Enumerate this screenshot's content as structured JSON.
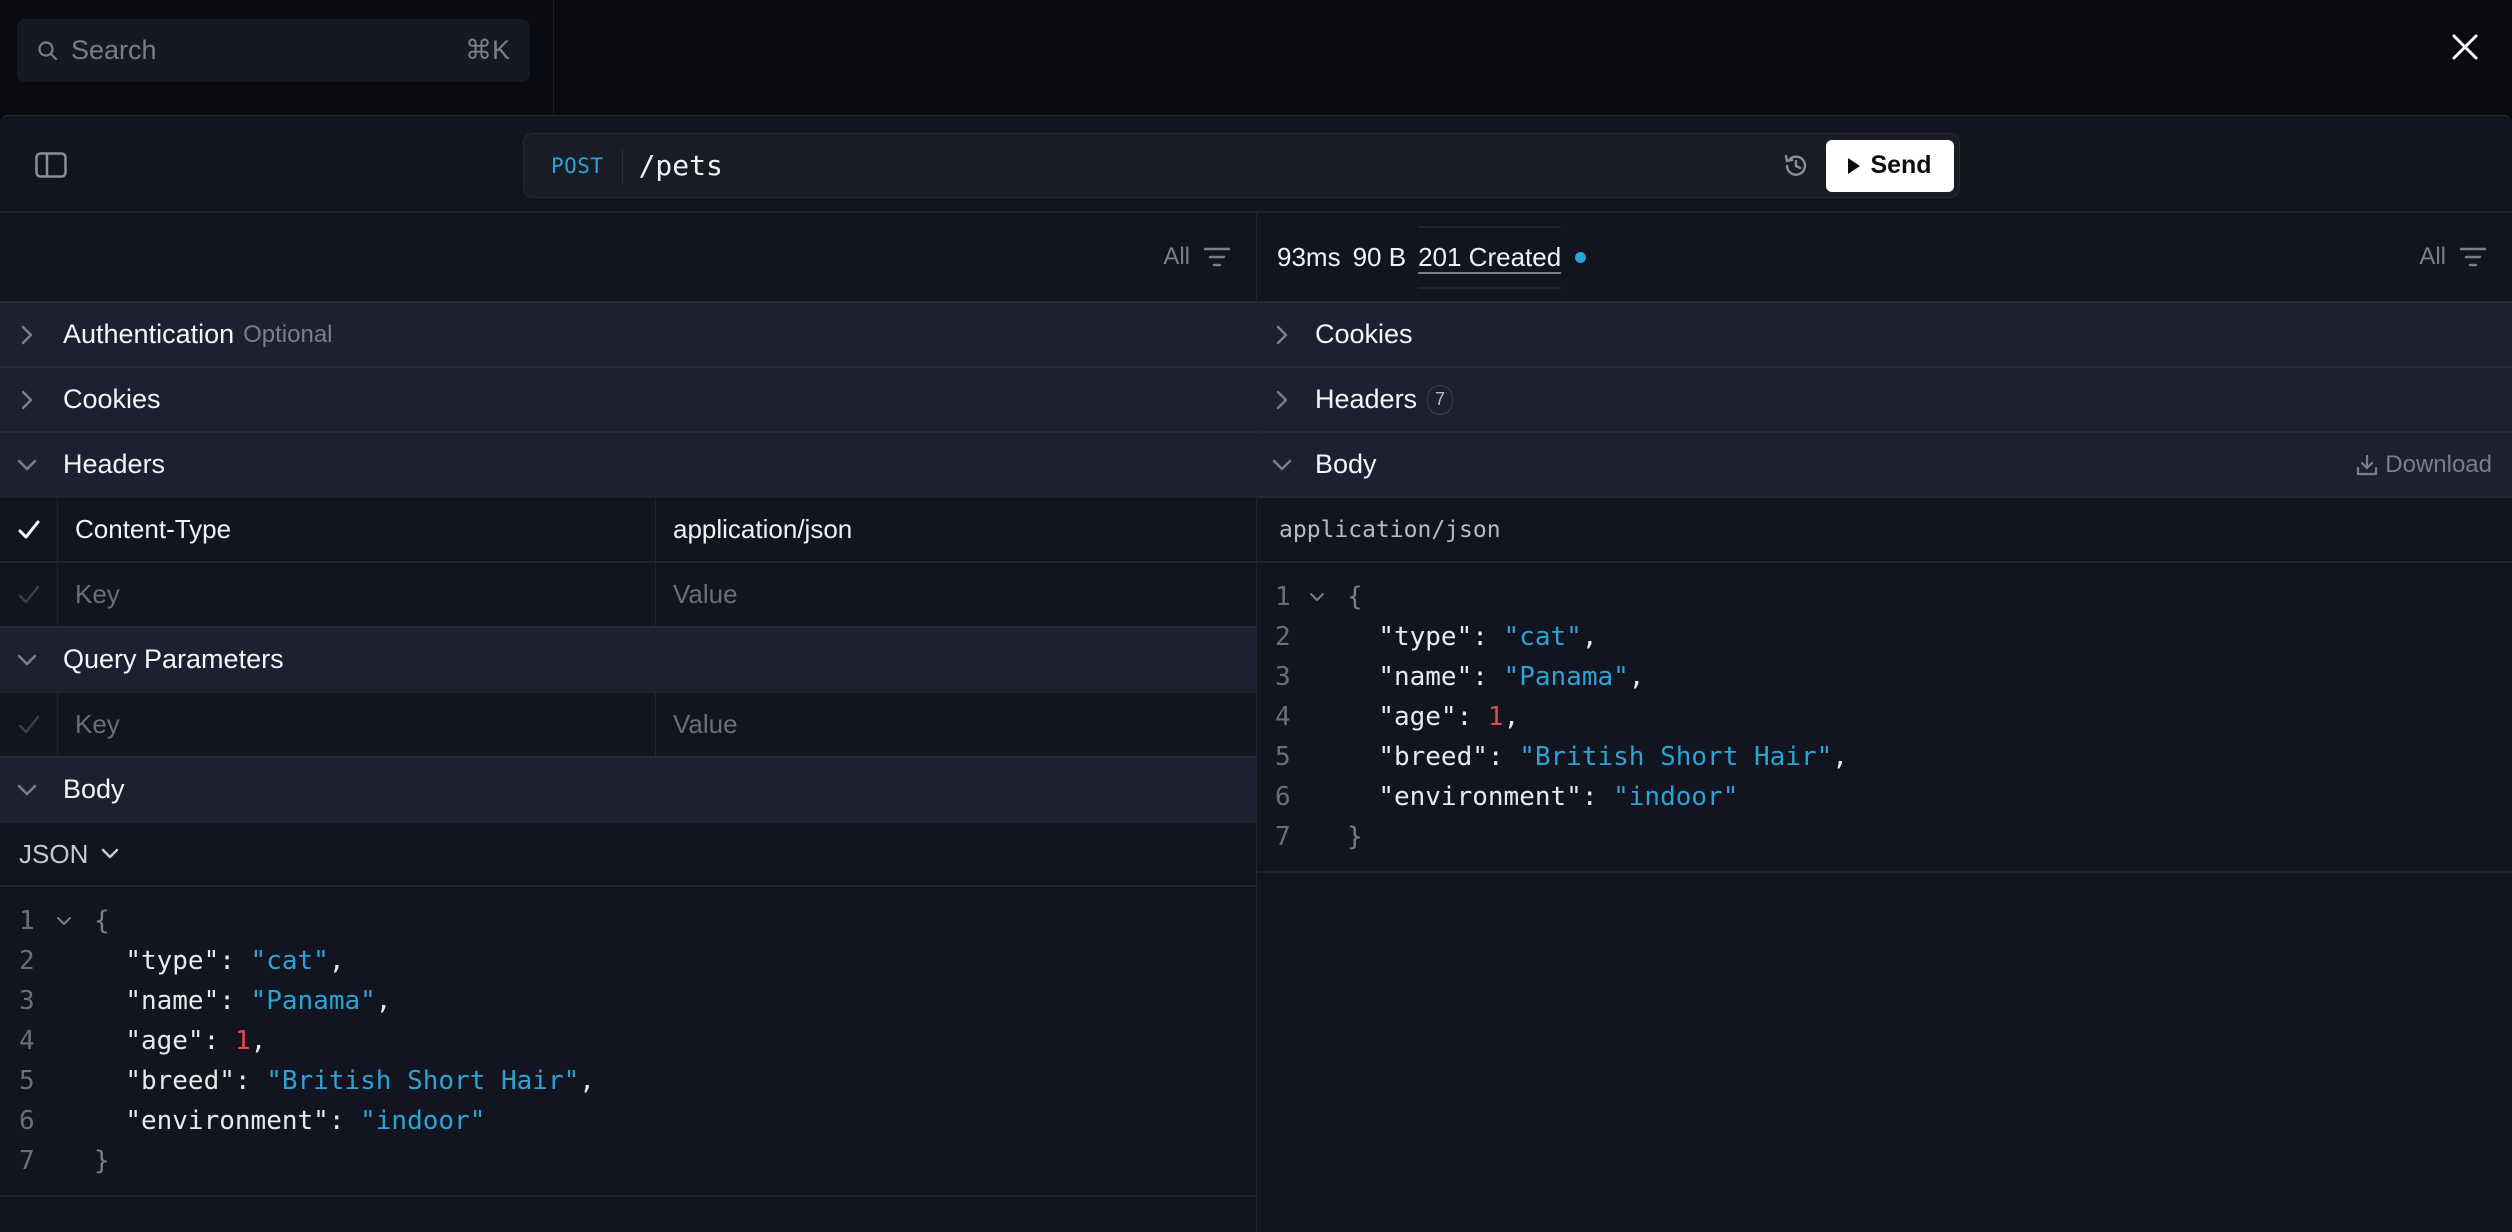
{
  "topbar": {
    "search_placeholder": "Search",
    "search_shortcut": "⌘K",
    "search_icon": "search-icon",
    "close_icon": "close-icon"
  },
  "toolbar": {
    "sidebar_toggle_icon": "sidebar-toggle-icon",
    "method": "POST",
    "path": "/pets",
    "history_icon": "history-icon",
    "send_label": "Send",
    "method_color": "#2ba3d4"
  },
  "request": {
    "filter_label": "All",
    "sections": {
      "authentication": {
        "title": "Authentication",
        "hint": "Optional",
        "expanded": false
      },
      "cookies": {
        "title": "Cookies",
        "expanded": false
      },
      "headers": {
        "title": "Headers",
        "expanded": true
      },
      "query": {
        "title": "Query Parameters",
        "expanded": true
      },
      "body": {
        "title": "Body",
        "expanded": true
      }
    },
    "headers": [
      {
        "enabled": true,
        "key": "Content-Type",
        "value": "application/json"
      }
    ],
    "headers_new_row": {
      "key_placeholder": "Key",
      "value_placeholder": "Value"
    },
    "query_new_row": {
      "key_placeholder": "Key",
      "value_placeholder": "Value"
    },
    "body_type": "JSON",
    "body_lines": [
      {
        "n": "1",
        "fold": true,
        "indent": "",
        "open": "{"
      },
      {
        "n": "2",
        "key": "\"type\"",
        "value": "\"cat\"",
        "kind": "str",
        "comma": ","
      },
      {
        "n": "3",
        "key": "\"name\"",
        "value": "\"Panama\"",
        "kind": "str",
        "comma": ","
      },
      {
        "n": "4",
        "key": "\"age\"",
        "value": "1",
        "kind": "num",
        "comma": ","
      },
      {
        "n": "5",
        "key": "\"breed\"",
        "value": "\"British Short Hair\"",
        "kind": "str",
        "comma": ","
      },
      {
        "n": "6",
        "key": "\"environment\"",
        "value": "\"indoor\"",
        "kind": "str",
        "comma": ""
      },
      {
        "n": "7",
        "close": "}"
      }
    ]
  },
  "response": {
    "time": "93ms",
    "size": "90 B",
    "status": "201 Created",
    "status_color": "#2ba3d4",
    "filter_label": "All",
    "sections": {
      "cookies": {
        "title": "Cookies",
        "expanded": false
      },
      "headers": {
        "title": "Headers",
        "count": "7",
        "expanded": false
      },
      "body": {
        "title": "Body",
        "expanded": true,
        "download_label": "Download"
      }
    },
    "content_type": "application/json",
    "body_lines": [
      {
        "n": "1",
        "fold": true,
        "open": "{"
      },
      {
        "n": "2",
        "key": "\"type\"",
        "value": "\"cat\"",
        "kind": "str",
        "comma": ","
      },
      {
        "n": "3",
        "key": "\"name\"",
        "value": "\"Panama\"",
        "kind": "str",
        "comma": ","
      },
      {
        "n": "4",
        "key": "\"age\"",
        "value": "1",
        "kind": "num",
        "comma": ","
      },
      {
        "n": "5",
        "key": "\"breed\"",
        "value": "\"British Short Hair\"",
        "kind": "str",
        "comma": ","
      },
      {
        "n": "6",
        "key": "\"environment\"",
        "value": "\"indoor\"",
        "kind": "str",
        "comma": ""
      },
      {
        "n": "7",
        "close": "}"
      }
    ]
  },
  "colors": {
    "string": "#2ba3d4",
    "number": "#e5484d",
    "accent": "#2ba3d4"
  }
}
